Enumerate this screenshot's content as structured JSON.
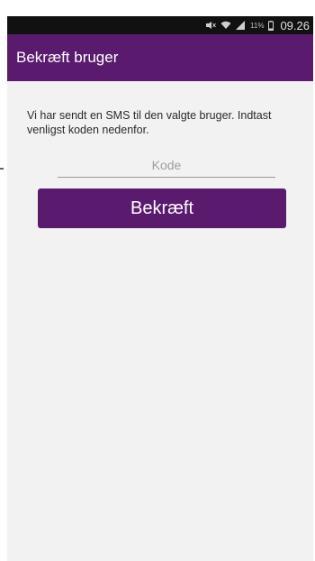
{
  "status_bar": {
    "time": "09.26",
    "battery_percent": "11%",
    "icons": [
      "mute-icon",
      "wifi-icon",
      "signal-icon",
      "battery-icon"
    ]
  },
  "app_bar": {
    "title": "Bekræft bruger",
    "color": "#5a1b6e"
  },
  "verification": {
    "message": "Vi har sendt en SMS til den valgte bruger. Indtast venligst koden nedenfor.",
    "code_placeholder": "Kode",
    "code_value": "",
    "confirm_label": "Bekræft"
  }
}
